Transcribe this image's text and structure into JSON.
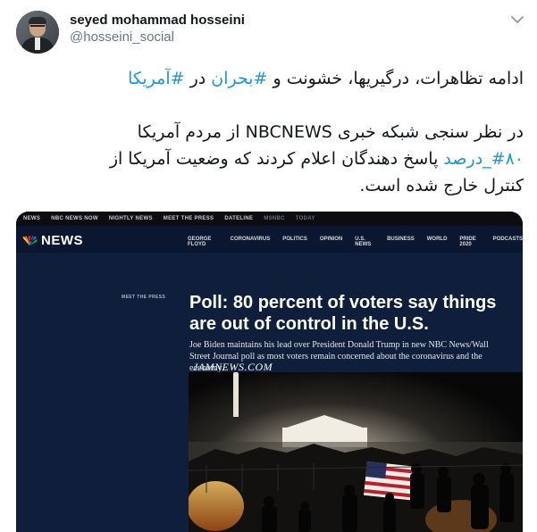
{
  "author": {
    "display_name": "seyed mohammad hosseini",
    "handle": "@hosseini_social"
  },
  "tweet": {
    "line1_text": "ادامه تظاهرات، درگیریها، خشونت و ",
    "line1_tag1": "#بحران",
    "line1_mid": " در ",
    "line1_tag2": "#آمریکا",
    "line2_text": "در نظر سنجی شبکه خبری NBCNEWS از مردم آمریکا",
    "line3_tag": "#۸۰_درصد",
    "line3_text": " پاسخ دهندگان اعلام کردند که وضعیت آمریکا از",
    "line4_text": "کنترل خارج شده است."
  },
  "card": {
    "topbar": [
      "NEWS",
      "NBC NEWS NOW",
      "NIGHTLY NEWS",
      "MEET THE PRESS",
      "DATELINE",
      "MSNBC",
      "TODAY"
    ],
    "logo_text": "NEWS",
    "nav": [
      "GEORGE FLOYD",
      "CORONAVIRUS",
      "POLITICS",
      "OPINION",
      "U.S. NEWS",
      "BUSINESS",
      "WORLD",
      "PRIDE 2020",
      "PODCASTS"
    ],
    "kicker": "MEET THE PRESS",
    "headline": "Poll: 80 percent of voters say things are out of control in the U.S.",
    "dek": "Joe Biden maintains his lead over President Donald Trump in new NBC News/Wall Street Journal poll as most voters remain concerned about the coronavirus and the economy.",
    "watermark": "JAMNEWS.COM"
  },
  "colors": {
    "hashtag": "#1b95e0",
    "handle": "#657786",
    "card_navy": "#0f1e3a"
  },
  "icons": [
    "chevron-down-icon",
    "nbc-peacock-icon"
  ]
}
